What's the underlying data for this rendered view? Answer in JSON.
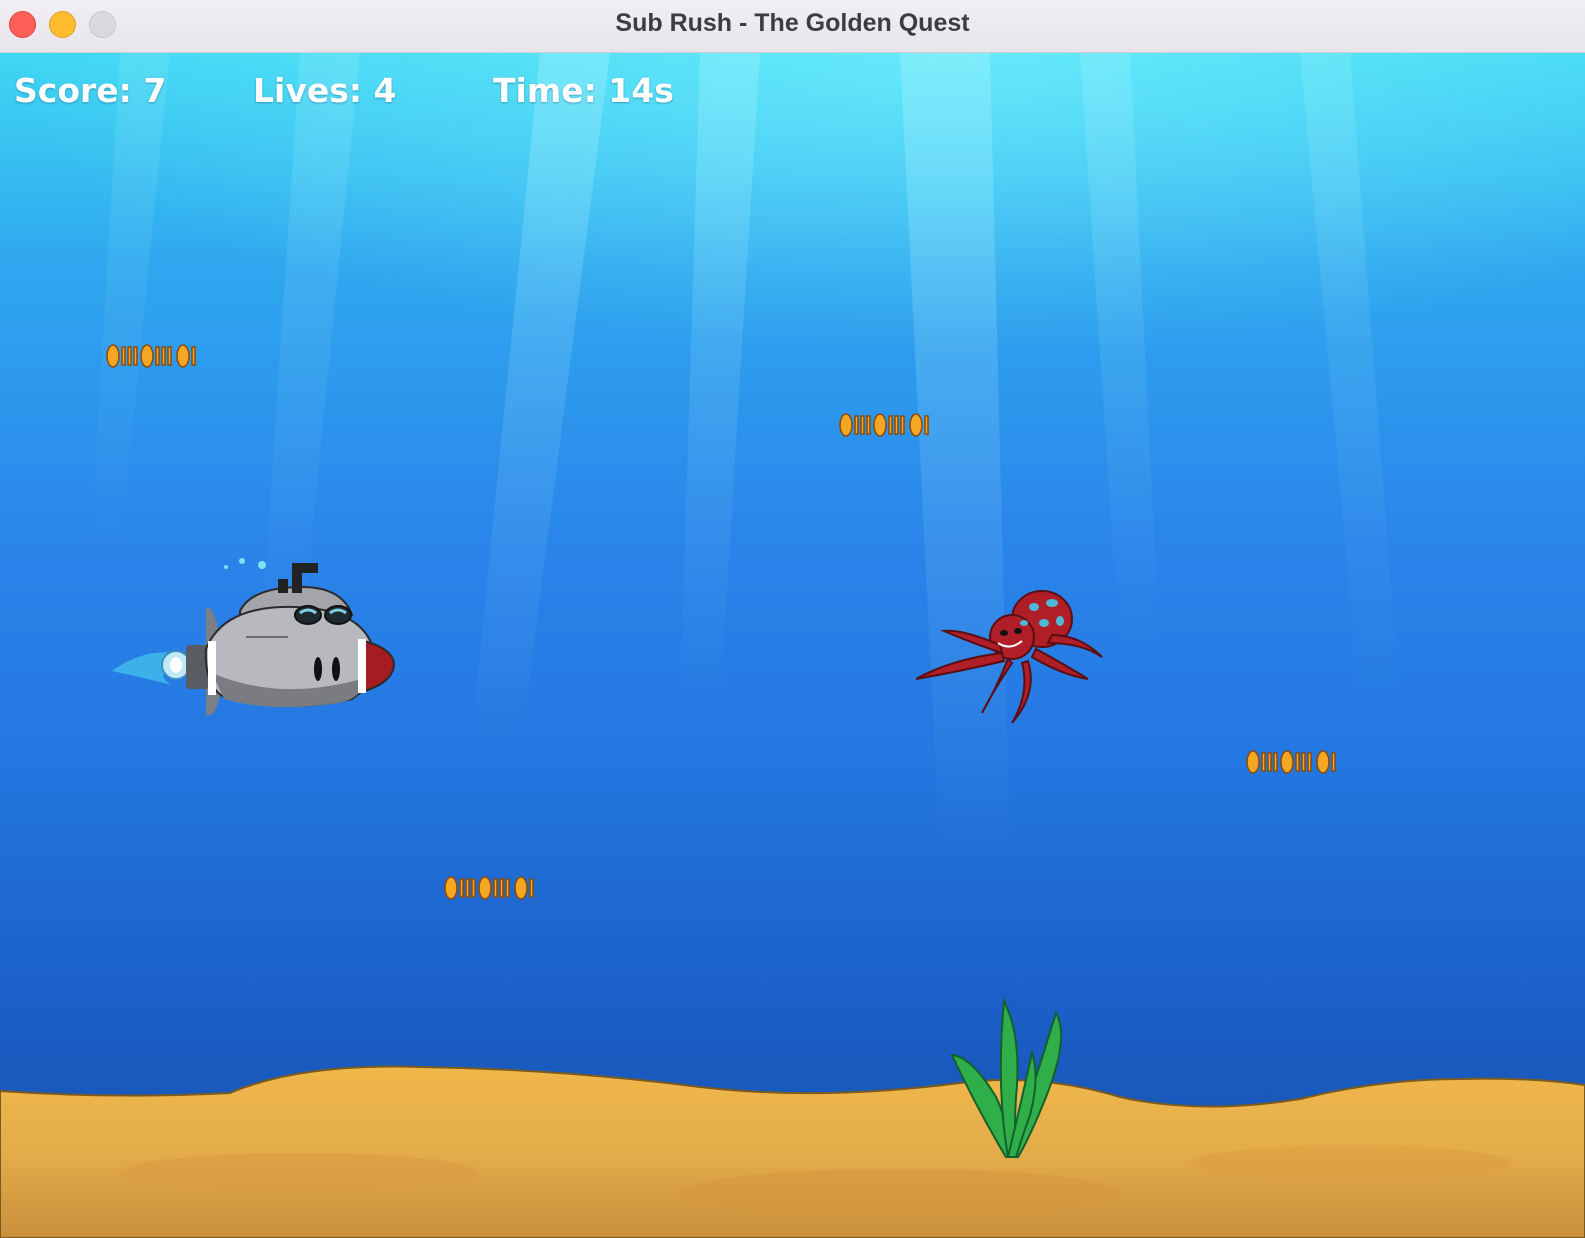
{
  "window": {
    "title": "Sub Rush - The Golden Quest"
  },
  "hud": {
    "score": "Score: 7",
    "lives": "Lives: 4",
    "time": "Time: 14s"
  },
  "colors": {
    "water_top": "#3fd7f3",
    "water_bottom": "#1650ad",
    "sand": "#e8b04a",
    "coin": "#f5a623",
    "octopus": "#b01e28",
    "seaweed": "#2fae4a",
    "submarine": "#b8b8b8"
  },
  "sprites": {
    "player": "submarine",
    "enemy": "octopus",
    "pickup": "coin-row",
    "decoration": "seaweed"
  }
}
